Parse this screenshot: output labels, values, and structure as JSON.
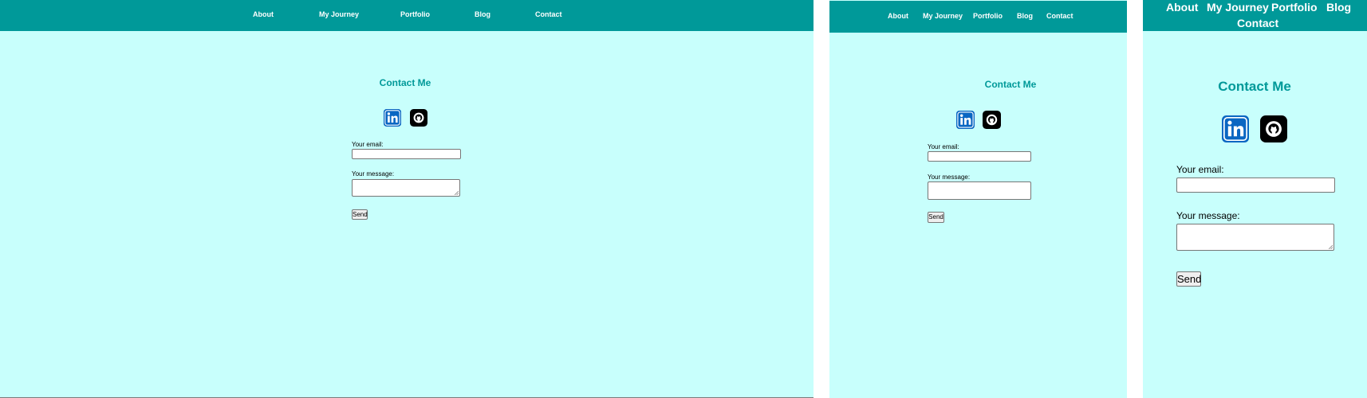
{
  "nav": {
    "items": [
      "About",
      "My Journey",
      "Portfolio",
      "Blog",
      "Contact"
    ]
  },
  "contact": {
    "heading": "Contact Me",
    "email_label": "Your email:",
    "message_label": "Your message:",
    "send_label": "Send",
    "email_value": "",
    "message_value": ""
  },
  "social": {
    "linkedin_icon": "linkedin-icon",
    "github_icon": "github-icon"
  },
  "colors": {
    "nav_background": "#009999",
    "page_background": "#c8fffc",
    "heading_color": "#009999",
    "linkedin_blue": "#0a66c2",
    "github_black": "#000000"
  }
}
